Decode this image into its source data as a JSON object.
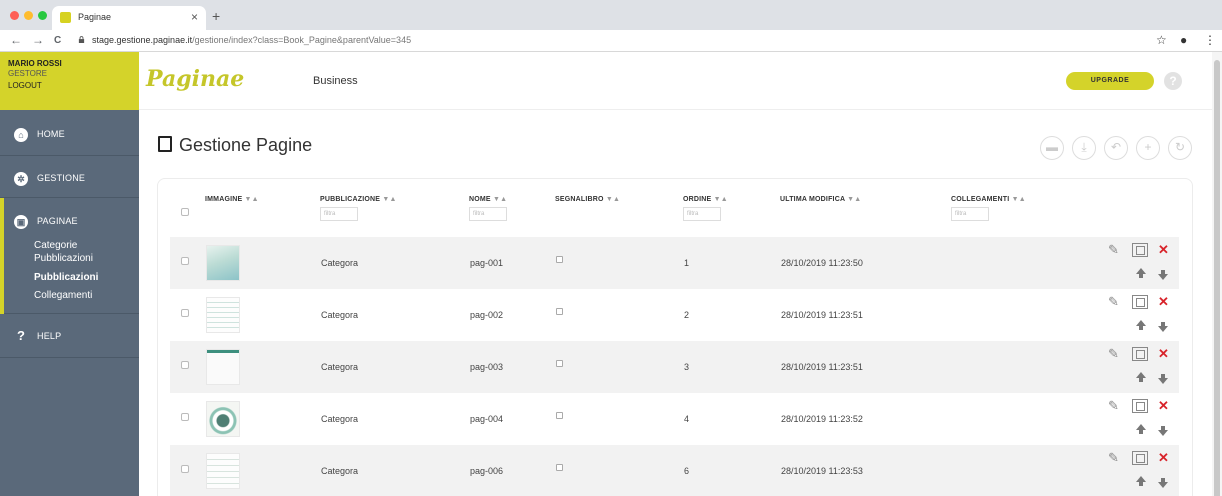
{
  "browser": {
    "tab_title": "Paginae",
    "url_host": "stage.gestione.paginae.it",
    "url_path": "/gestione/index?class=Book_Pagine&parentValue=345",
    "new_tab": "+",
    "close_tab": "×",
    "back": "←",
    "forward": "→",
    "reload": "C",
    "star": "☆",
    "account": "●",
    "menu": "⋮"
  },
  "user": {
    "name": "MARIO ROSSI",
    "role": "GESTORE",
    "logout": "LOGOUT"
  },
  "sidebar": {
    "home": "HOME",
    "gestione": "GESTIONE",
    "paginae": "PAGINAE",
    "sub_categorie": "Categorie",
    "sub_pubblicazioni_1": "Pubblicazioni",
    "sub_pubblicazioni_2": "Pubblicazioni",
    "sub_collegamenti": "Collegamenti",
    "help": "HELP"
  },
  "header": {
    "logo": "Paginae",
    "business": "Business",
    "upgrade": "UPGRADE",
    "help_icon": "?"
  },
  "page": {
    "title": "Gestione Pagine"
  },
  "table": {
    "columns": {
      "immagine": "IMMAGINE",
      "pubblicazione": "PUBBLICAZIONE",
      "nome": "NOME",
      "segnalibro": "SEGNALIBRO",
      "ordine": "ORDINE",
      "ultima_modifica": "ULTIMA MODIFICA",
      "collegamenti": "COLLEGAMENTI"
    },
    "sort_glyph": "▼▲",
    "filter_placeholder": "filtra",
    "rows": [
      {
        "pubblicazione": "Categora",
        "nome": "pag-001",
        "ordine": "1",
        "modifica": "28/10/2019 11:23:50"
      },
      {
        "pubblicazione": "Categora",
        "nome": "pag-002",
        "ordine": "2",
        "modifica": "28/10/2019 11:23:51"
      },
      {
        "pubblicazione": "Categora",
        "nome": "pag-003",
        "ordine": "3",
        "modifica": "28/10/2019 11:23:51"
      },
      {
        "pubblicazione": "Categora",
        "nome": "pag-004",
        "ordine": "4",
        "modifica": "28/10/2019 11:23:52"
      },
      {
        "pubblicazione": "Categora",
        "nome": "pag-006",
        "ordine": "6",
        "modifica": "28/10/2019 11:23:53"
      }
    ]
  },
  "colors": {
    "accent": "#d4d32a",
    "sidebar": "#5a697a",
    "delete": "#d8232a"
  }
}
